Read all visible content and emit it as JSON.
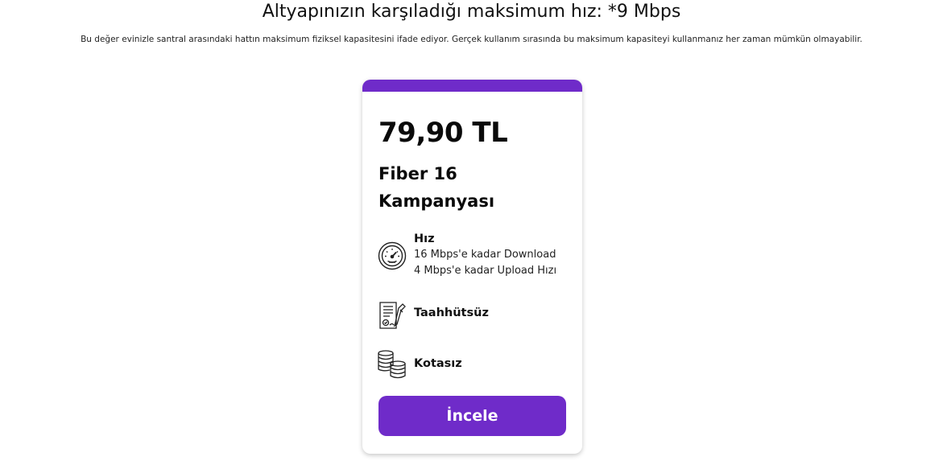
{
  "header": {
    "title": "Altyapınızın karşıladığı maksimum hız: *9 Mbps",
    "description": "Bu değer evinizle santral arasındaki hattın maksimum fiziksel kapasitesini ifade ediyor. Gerçek kullanım sırasında bu maksimum kapasiteyi kullanmanız her zaman mümkün olmayabilir."
  },
  "card": {
    "accent_color": "#6f2bc9",
    "price": "79,90 TL",
    "plan_name": "Fiber 16 Kampanyası",
    "features": [
      {
        "icon": "speedometer-icon",
        "title": "Hız",
        "lines": [
          "16 Mbps'e kadar Download",
          "4 Mbps'e kadar Upload Hızı"
        ]
      },
      {
        "icon": "contract-document-icon",
        "title": "Taahhütsüz"
      },
      {
        "icon": "coin-stack-icon",
        "title": "Kotasız"
      }
    ],
    "button_label": "İncele"
  }
}
